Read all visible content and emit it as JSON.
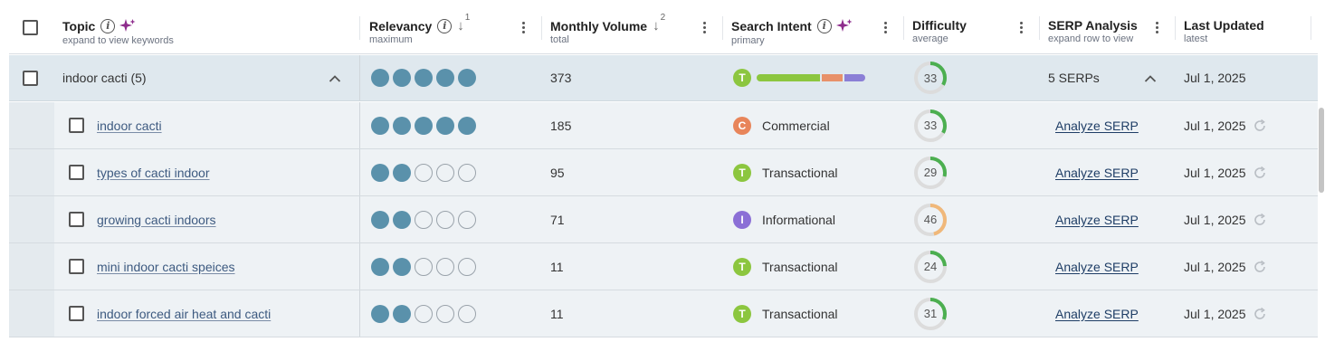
{
  "header": {
    "topic": {
      "label": "Topic",
      "sub": "expand to view keywords"
    },
    "relevancy": {
      "label": "Relevancy",
      "sub": "maximum",
      "sort_order": "1"
    },
    "monthly_volume": {
      "label": "Monthly Volume",
      "sub": "total",
      "sort_order": "2"
    },
    "search_intent": {
      "label": "Search Intent",
      "sub": "primary"
    },
    "difficulty": {
      "label": "Difficulty",
      "sub": "average"
    },
    "serp_analysis": {
      "label": "SERP Analysis",
      "sub": "expand row to view"
    },
    "last_updated": {
      "label": "Last Updated",
      "sub": "latest"
    }
  },
  "group": {
    "topic": "indoor cacti (5)",
    "relevancy": 5,
    "volume": "373",
    "intent_letter": "T",
    "intent_color": "#8cc63f",
    "intent_mix": [
      {
        "color": "#8cc63f",
        "share": 0.6
      },
      {
        "color": "#e8916a",
        "share": 0.2
      },
      {
        "color": "#8b7fd6",
        "share": 0.2
      }
    ],
    "difficulty": 33,
    "serps": "5 SERPs",
    "updated": "Jul 1, 2025"
  },
  "rows": [
    {
      "keyword": "indoor cacti",
      "relevancy": 5,
      "volume": "185",
      "intent_letter": "C",
      "intent": "Commercial",
      "intent_color": "#e8855a",
      "difficulty": 33,
      "serp": "Analyze SERP",
      "updated": "Jul 1, 2025"
    },
    {
      "keyword": "types of cacti indoor",
      "relevancy": 2,
      "volume": "95",
      "intent_letter": "T",
      "intent": "Transactional",
      "intent_color": "#8cc63f",
      "difficulty": 29,
      "serp": "Analyze SERP",
      "updated": "Jul 1, 2025"
    },
    {
      "keyword": "growing cacti indoors",
      "relevancy": 2,
      "volume": "71",
      "intent_letter": "I",
      "intent": "Informational",
      "intent_color": "#8b6fd6",
      "difficulty": 46,
      "serp": "Analyze SERP",
      "updated": "Jul 1, 2025"
    },
    {
      "keyword": "mini indoor cacti speices",
      "relevancy": 2,
      "volume": "11",
      "intent_letter": "T",
      "intent": "Transactional",
      "intent_color": "#8cc63f",
      "difficulty": 24,
      "serp": "Analyze SERP",
      "updated": "Jul 1, 2025"
    },
    {
      "keyword": "indoor forced air heat and cacti",
      "relevancy": 2,
      "volume": "11",
      "intent_letter": "T",
      "intent": "Transactional",
      "intent_color": "#8cc63f",
      "difficulty": 31,
      "serp": "Analyze SERP",
      "updated": "Jul 1, 2025"
    }
  ],
  "colors": {
    "difficulty_easy": "#4caf50",
    "difficulty_medium": "#f0b87a",
    "gauge_track": "#dcdcdc"
  },
  "icons": [
    "info-icon",
    "sparkle-icon",
    "sort-down-icon",
    "kebab-icon",
    "chevron-up-icon",
    "refresh-icon",
    "checkbox"
  ]
}
